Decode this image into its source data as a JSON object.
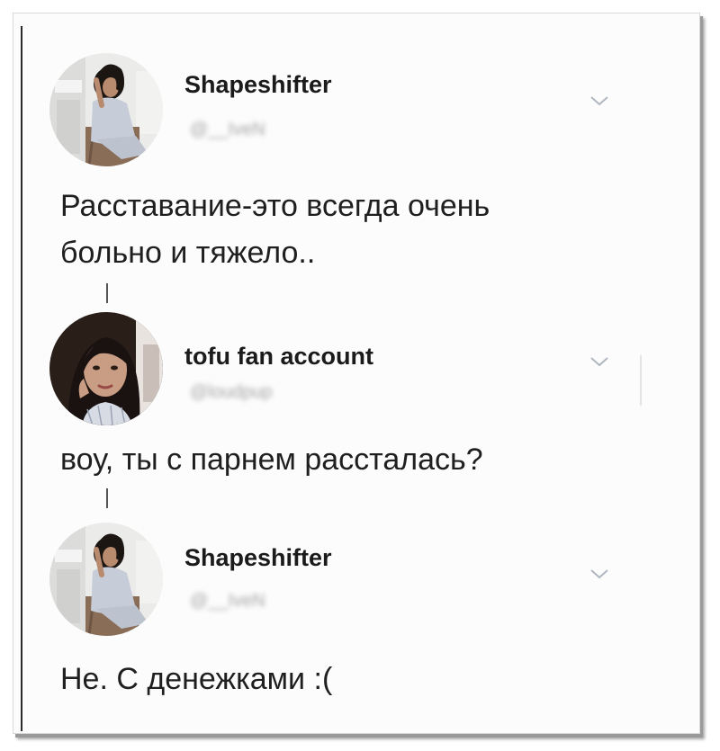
{
  "tweets": [
    {
      "name": "Shapeshifter",
      "handle": "@__IveN",
      "text_lines": [
        "Расставание-это всегда очень",
        "больно и тяжело.."
      ],
      "avatar": "avatar-girl-chair"
    },
    {
      "name": "tofu fan account",
      "handle": "@loudpup",
      "text_lines": [
        "воу, ты с парнем рассталась?"
      ],
      "avatar": "avatar-girl-portrait"
    },
    {
      "name": "Shapeshifter",
      "handle": "@__IveN",
      "text_lines": [
        "Не. С денежками :("
      ],
      "avatar": "avatar-girl-chair"
    }
  ],
  "icons": {
    "chevron": "chevron-down-icon"
  },
  "colors": {
    "text": "#1f1f1f",
    "name": "#1b1b1b",
    "handle": "#a6a6a6",
    "chevron": "#b0b7c0"
  }
}
